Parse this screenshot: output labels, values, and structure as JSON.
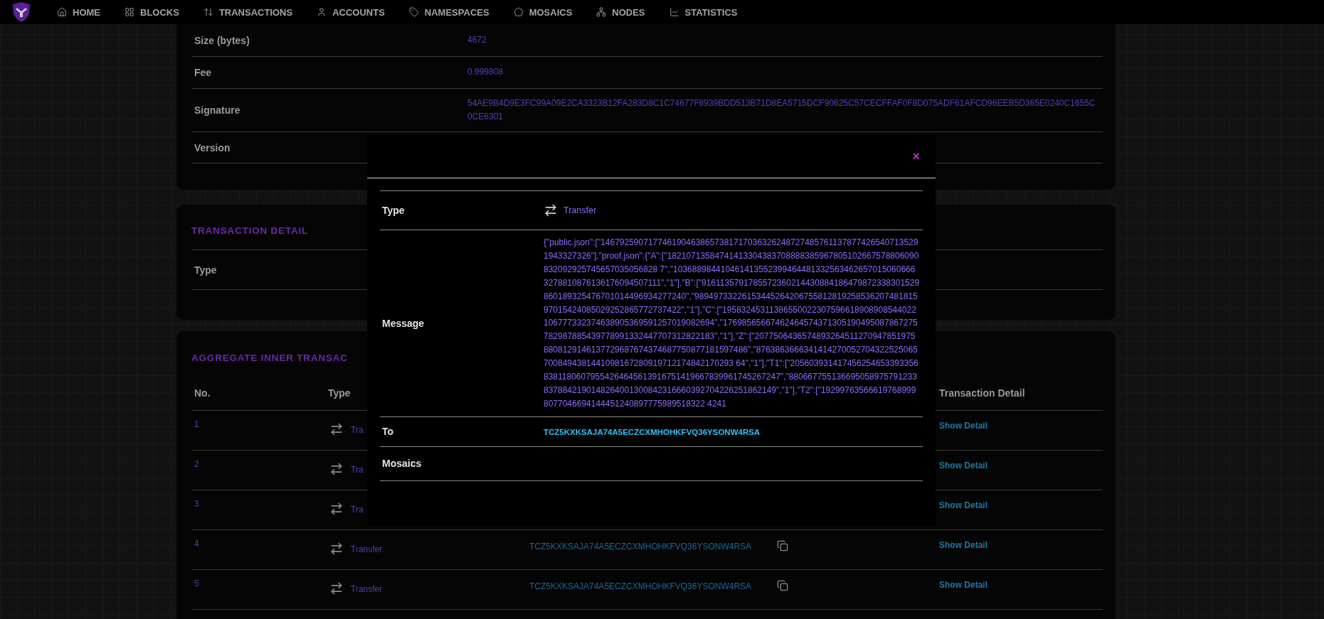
{
  "nav": {
    "items": [
      {
        "label": "HOME"
      },
      {
        "label": "BLOCKS"
      },
      {
        "label": "TRANSACTIONS"
      },
      {
        "label": "ACCOUNTS"
      },
      {
        "label": "NAMESPACES"
      },
      {
        "label": "MOSAICS"
      },
      {
        "label": "NODES"
      },
      {
        "label": "STATISTICS"
      }
    ]
  },
  "transaction_info": {
    "rows": [
      {
        "label": "Size (bytes)",
        "value": "4672"
      },
      {
        "label": "Fee",
        "value": "0.999808"
      },
      {
        "label": "Signature",
        "value": "54AE9B4D9E3FC99A09E2CA3323B12FA283D8C1C74677F8939BDD513B71D8EA5715DCF90625C57CECFFAF0F8D075ADF61AFCD96EEB5D365E0240C1655C0CE6301"
      },
      {
        "label": "Version"
      }
    ]
  },
  "transaction_detail": {
    "title": "TRANSACTION DETAIL",
    "rows": [
      {
        "label": "Type"
      }
    ]
  },
  "aggregate_inner_transactions": {
    "title": "AGGREGATE INNER TRANSAC",
    "header": {
      "no": "No.",
      "type": "Type",
      "detail": "Transaction Detail"
    },
    "rows": [
      {
        "no": "1",
        "type": "Tra",
        "detail": "Show Detail"
      },
      {
        "no": "2",
        "type": "Tra",
        "detail": "Show Detail"
      },
      {
        "no": "3",
        "type": "Tra",
        "detail": "Show Detail"
      },
      {
        "no": "4",
        "type": "Transfer",
        "address": "TCZ5KXKSAJA74A5ECZCXMHOHKFVQ36YSONW4RSA",
        "detail": "Show Detail"
      },
      {
        "no": "5",
        "type": "Transfer",
        "address": "TCZ5KXKSAJA74A5ECZCXMHOHKFVQ36YSONW4RSA",
        "detail": "Show Detail"
      }
    ]
  },
  "modal": {
    "close": "×",
    "rows": [
      {
        "kind": "type",
        "label": "Type",
        "value": "Transfer"
      },
      {
        "kind": "text",
        "label": "Message",
        "value": "{\"public.json\":[\"14679259071774619046386573817170363262487274857611378774265407135291943327326\"],\"proof.json\":{\"A\":[\"18210713584741413304383708888385967805102667578806090832092925745657035056828 7\",\"1036889844104614135523994644813325634626570150606663278810876136176094507111\",\"1\"],\"B\":[\"9161135791785572360214430884186479872338301529860189325476701014496934277240\",\"9894973322615344526420675581281925853620748181597015424085029252865772737422\",\"1\"],\"C\":[\"19583245311386550022307596618908908544022106777332374638905369591257019082694\",\"17698565667462464574371305190495087867275782987885439778991332447707312822183\",\"1\"],\"Z\":[\"20775064365748932645112709478519758808129146137729687674374687750877181597486\",\"87638636663414142700527043225250657008494381441098167280919712174842170293 64\",\"1\"],\"T1\":[\"20560393141745625465339335683811806079554264645613916751419667839961745267247\",\"8806677551366950589757912338378842190148264001300842316660392704226251862149\",\"1\"],\"T2\":[\"192997635666197689998077046694144451240897775989518322 4241"
      },
      {
        "kind": "address",
        "label": "To",
        "value": "TCZ5KXKSAJA74A5ECZCXMHOHKFVQ36YSONW4RSA"
      },
      {
        "kind": "empty",
        "label": "Mosaics"
      }
    ]
  }
}
